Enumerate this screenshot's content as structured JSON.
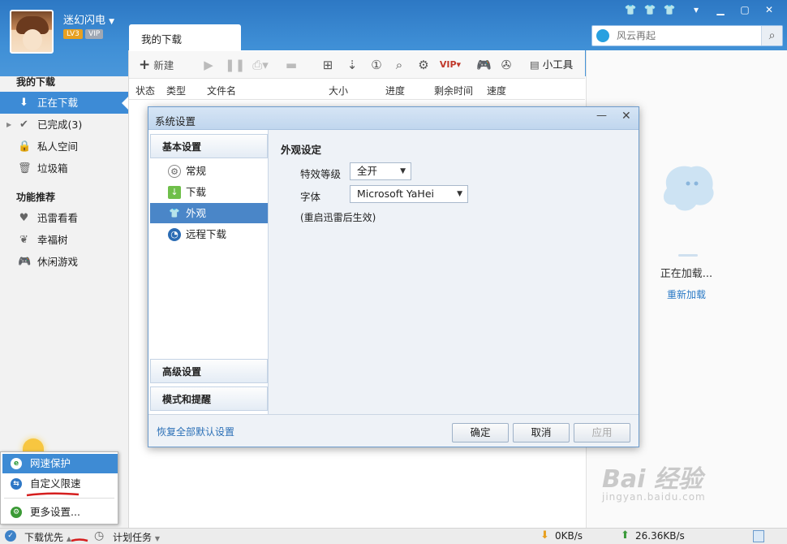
{
  "user": {
    "name": "迷幻闪电",
    "level": "LV3",
    "vip": "VIP"
  },
  "window_controls": {
    "skin1": "skin-icon",
    "skin2": "skin-icon",
    "skin3": "skin-icon",
    "menu": "menu-icon",
    "minimize": "minimize-icon",
    "maximize": "maximize-icon",
    "close": "close-icon"
  },
  "search": {
    "placeholder": "风云再起"
  },
  "sidebar": {
    "section1": "我的下载",
    "items": [
      {
        "label": "正在下载",
        "icon": "download-icon"
      },
      {
        "label": "已完成(3)",
        "icon": "check-icon"
      },
      {
        "label": "私人空间",
        "icon": "lock-icon"
      },
      {
        "label": "垃圾箱",
        "icon": "trash-icon"
      }
    ],
    "section2": "功能推荐",
    "features": [
      {
        "label": "迅雷看看",
        "icon": "play-shield-icon"
      },
      {
        "label": "幸福树",
        "icon": "leaf-icon"
      },
      {
        "label": "休闲游戏",
        "icon": "gamepad-icon"
      }
    ]
  },
  "main": {
    "tab": "我的下载",
    "toolbar": {
      "new": "新建",
      "tools": "小工具"
    },
    "columns": [
      "状态",
      "类型",
      "文件名",
      "大小",
      "进度",
      "剩余时间",
      "速度"
    ]
  },
  "right": {
    "loading": "正在加载...",
    "reload": "重新加载"
  },
  "dialog": {
    "title": "系统设置",
    "categories": {
      "basic": "基本设置",
      "advanced": "高级设置",
      "modes": "模式和提醒"
    },
    "items": [
      "常规",
      "下载",
      "外观",
      "远程下载"
    ],
    "section_title": "外观设定",
    "effect_label": "特效等级",
    "effect_value": "全开",
    "font_label": "字体",
    "font_value": "Microsoft YaHei",
    "note": "(重启迅雷后生效)",
    "restore": "恢复全部默认设置",
    "ok": "确定",
    "cancel": "取消",
    "apply": "应用"
  },
  "popup": {
    "items": [
      "网速保护",
      "自定义限速",
      "更多设置..."
    ],
    "colors": [
      "#2e9a3c",
      "#2f78c6",
      "#3b9a35"
    ]
  },
  "bottom": {
    "priority": "下载优先",
    "plan": "计划任务",
    "down_speed": "0KB/s",
    "up_speed": "26.36KB/s"
  },
  "watermark": {
    "brand": "Bai  经验",
    "url": "jingyan.baidu.com"
  },
  "colors": {
    "accent": "#3d8bd6",
    "title_bar": "#2d78c4"
  }
}
